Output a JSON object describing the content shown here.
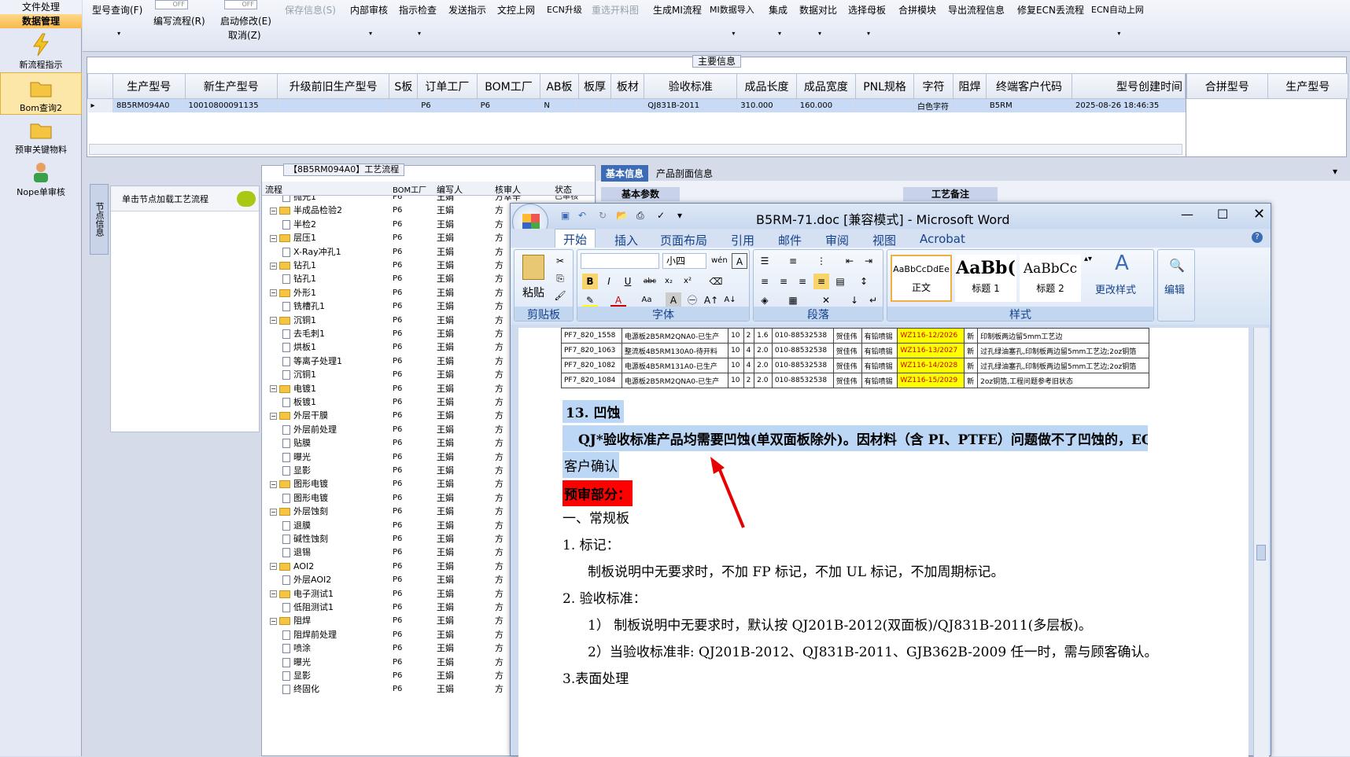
{
  "sidebar": {
    "top_label": "文件处理",
    "section_label": "数据管理",
    "items": [
      {
        "label": "新流程指示",
        "icon": "lightning-icon"
      },
      {
        "label": "Bom查询2",
        "icon": "folder-icon"
      },
      {
        "label": "预审关键物料",
        "icon": "folder-icon"
      },
      {
        "label": "Nope单审核",
        "icon": "user-icon"
      }
    ]
  },
  "toolbar": {
    "items": [
      {
        "label": "型号查询(F)",
        "dropdown": "▾"
      },
      {
        "label": "编写流程(R)"
      },
      {
        "label": "启动修改(E)",
        "sub": "取消(Z)"
      },
      {
        "label": "保存信息(S)"
      },
      {
        "label": "内部审核",
        "dropdown": "▾"
      },
      {
        "label": "指示检查",
        "dropdown": "▾"
      },
      {
        "label": "发送指示"
      },
      {
        "label": "文控上网"
      },
      {
        "label": "ECN升级"
      },
      {
        "label": "重选开料图"
      },
      {
        "label": "生成MI流程"
      },
      {
        "label": "MI数据导入",
        "dropdown": "▾"
      },
      {
        "label": "集成",
        "dropdown": "▾"
      },
      {
        "label": "数据对比",
        "dropdown": "▾"
      },
      {
        "label": "选择母板",
        "dropdown": "▾"
      },
      {
        "label": "合拼模块"
      },
      {
        "label": "导出流程信息"
      },
      {
        "label": "修复ECN丢流程"
      },
      {
        "label": "ECN自动上网",
        "dropdown": "▾"
      }
    ],
    "toggle_off": "OFF"
  },
  "main_info": {
    "legend": "主要信息",
    "columns": [
      "生产型号",
      "新生产型号",
      "升级前旧生产型号",
      "S板",
      "订单工厂",
      "BOM工厂",
      "AB板",
      "板厚",
      "板材",
      "验收标准",
      "成品长度",
      "成品宽度",
      "PNL规格",
      "字符",
      "阻焊",
      "终端客户代码",
      "型号创建时间"
    ],
    "row": [
      "8B5RM094A0",
      "10010800091135",
      "",
      "",
      "P6",
      "P6",
      "N",
      "",
      "",
      "QJ831B-2011",
      "310.000",
      "160.000",
      "",
      "白色字符",
      "",
      "B5RM",
      "2025-08-26 18:46:35"
    ],
    "side_columns": [
      "合拼型号",
      "生产型号"
    ]
  },
  "node_panel": {
    "vertical_tab": "节点信息",
    "header": "单击节点加载工艺流程"
  },
  "process": {
    "legend": "【8B5RM094A0】工艺流程",
    "columns": [
      "流程",
      "BOM工厂",
      "编写人",
      "核审人",
      "状态"
    ],
    "rows": [
      {
        "name": "抛光1",
        "level": 2,
        "type": "doc",
        "factory": "P6",
        "writer": "王娟",
        "reviewer": "方幸辛",
        "status": "已审核"
      },
      {
        "name": "半成品检验2",
        "level": 1,
        "type": "folder",
        "factory": "P6",
        "writer": "王娟",
        "reviewer": "方"
      },
      {
        "name": "半检2",
        "level": 2,
        "type": "doc",
        "factory": "P6",
        "writer": "王娟",
        "reviewer": "方"
      },
      {
        "name": "层压1",
        "level": 1,
        "type": "folder",
        "factory": "P6",
        "writer": "王娟",
        "reviewer": "方"
      },
      {
        "name": "X-Ray冲孔1",
        "level": 2,
        "type": "doc",
        "factory": "P6",
        "writer": "王娟",
        "reviewer": "方"
      },
      {
        "name": "钻孔1",
        "level": 1,
        "type": "folder",
        "factory": "P6",
        "writer": "王娟",
        "reviewer": "方"
      },
      {
        "name": "钻孔1",
        "level": 2,
        "type": "doc",
        "factory": "P6",
        "writer": "王娟",
        "reviewer": "方"
      },
      {
        "name": "外形1",
        "level": 1,
        "type": "folder",
        "factory": "P6",
        "writer": "王娟",
        "reviewer": "方"
      },
      {
        "name": "铣槽孔1",
        "level": 2,
        "type": "doc",
        "factory": "P6",
        "writer": "王娟",
        "reviewer": "方"
      },
      {
        "name": "沉铜1",
        "level": 1,
        "type": "folder",
        "factory": "P6",
        "writer": "王娟",
        "reviewer": "方"
      },
      {
        "name": "去毛刺1",
        "level": 2,
        "type": "doc",
        "factory": "P6",
        "writer": "王娟",
        "reviewer": "方"
      },
      {
        "name": "烘板1",
        "level": 2,
        "type": "doc",
        "factory": "P6",
        "writer": "王娟",
        "reviewer": "方"
      },
      {
        "name": "等离子处理1",
        "level": 2,
        "type": "doc",
        "factory": "P6",
        "writer": "王娟",
        "reviewer": "方"
      },
      {
        "name": "沉铜1",
        "level": 2,
        "type": "doc",
        "factory": "P6",
        "writer": "王娟",
        "reviewer": "方"
      },
      {
        "name": "电镀1",
        "level": 1,
        "type": "folder",
        "factory": "P6",
        "writer": "王娟",
        "reviewer": "方"
      },
      {
        "name": "板镀1",
        "level": 2,
        "type": "doc",
        "factory": "P6",
        "writer": "王娟",
        "reviewer": "方"
      },
      {
        "name": "外层干膜",
        "level": 1,
        "type": "folder",
        "factory": "P6",
        "writer": "王娟",
        "reviewer": "方"
      },
      {
        "name": "外层前处理",
        "level": 2,
        "type": "doc",
        "factory": "P6",
        "writer": "王娟",
        "reviewer": "方"
      },
      {
        "name": "贴膜",
        "level": 2,
        "type": "doc",
        "factory": "P6",
        "writer": "王娟",
        "reviewer": "方"
      },
      {
        "name": "曝光",
        "level": 2,
        "type": "doc",
        "factory": "P6",
        "writer": "王娟",
        "reviewer": "方"
      },
      {
        "name": "显影",
        "level": 2,
        "type": "doc",
        "factory": "P6",
        "writer": "王娟",
        "reviewer": "方"
      },
      {
        "name": "图形电镀",
        "level": 1,
        "type": "folder",
        "factory": "P6",
        "writer": "王娟",
        "reviewer": "方"
      },
      {
        "name": "图形电镀",
        "level": 2,
        "type": "doc",
        "factory": "P6",
        "writer": "王娟",
        "reviewer": "方"
      },
      {
        "name": "外层蚀刻",
        "level": 1,
        "type": "folder",
        "factory": "P6",
        "writer": "王娟",
        "reviewer": "方"
      },
      {
        "name": "退膜",
        "level": 2,
        "type": "doc",
        "factory": "P6",
        "writer": "王娟",
        "reviewer": "方"
      },
      {
        "name": "碱性蚀刻",
        "level": 2,
        "type": "doc",
        "factory": "P6",
        "writer": "王娟",
        "reviewer": "方"
      },
      {
        "name": "退锡",
        "level": 2,
        "type": "doc",
        "factory": "P6",
        "writer": "王娟",
        "reviewer": "方"
      },
      {
        "name": "AOI2",
        "level": 1,
        "type": "folder",
        "factory": "P6",
        "writer": "王娟",
        "reviewer": "方"
      },
      {
        "name": "外层AOI2",
        "level": 2,
        "type": "doc",
        "factory": "P6",
        "writer": "王娟",
        "reviewer": "方"
      },
      {
        "name": "电子测试1",
        "level": 1,
        "type": "folder",
        "factory": "P6",
        "writer": "王娟",
        "reviewer": "方"
      },
      {
        "name": "低阻测试1",
        "level": 2,
        "type": "doc",
        "factory": "P6",
        "writer": "王娟",
        "reviewer": "方"
      },
      {
        "name": "阻焊",
        "level": 1,
        "type": "folder",
        "factory": "P6",
        "writer": "王娟",
        "reviewer": "方"
      },
      {
        "name": "阻焊前处理",
        "level": 2,
        "type": "doc",
        "factory": "P6",
        "writer": "王娟",
        "reviewer": "方"
      },
      {
        "name": "喷涂",
        "level": 2,
        "type": "doc",
        "factory": "P6",
        "writer": "王娟",
        "reviewer": "方"
      },
      {
        "name": "曝光",
        "level": 2,
        "type": "doc",
        "factory": "P6",
        "writer": "王娟",
        "reviewer": "方"
      },
      {
        "name": "显影",
        "level": 2,
        "type": "doc",
        "factory": "P6",
        "writer": "王娟",
        "reviewer": "方"
      },
      {
        "name": "终固化",
        "level": 2,
        "type": "doc",
        "factory": "P6",
        "writer": "王娟",
        "reviewer": "方"
      }
    ]
  },
  "info_panel": {
    "tabs": [
      "基本信息",
      "产品剖面信息"
    ],
    "sub_tab1": "基本参数",
    "sub_tab2": "工艺备注"
  },
  "word": {
    "title": "B5RM-71.doc [兼容模式] - Microsoft Word",
    "ribbon_tabs": [
      "开始",
      "插入",
      "页面布局",
      "引用",
      "邮件",
      "审阅",
      "视图",
      "Acrobat"
    ],
    "groups": [
      "剪贴板",
      "字体",
      "段落",
      "样式"
    ],
    "paste_label": "粘贴",
    "font_size": "小四",
    "styles": [
      {
        "preview": "AaBbCcDdEe",
        "name": "正文"
      },
      {
        "preview": "AaBb(",
        "name": "标题 1"
      },
      {
        "preview": "AaBbCc",
        "name": "标题 2"
      }
    ],
    "change_styles": "更改样式",
    "edit": "编辑",
    "table_rows": [
      [
        "PF7_820_1558",
        "电源板2B5RM2QNA0-已生产",
        "10",
        "2",
        "1.6",
        "010-88532538",
        "贺佳伟",
        "有铅喷锡",
        "WZ116-12/2026",
        "新",
        "印制板两边留5mm工艺边"
      ],
      [
        "PF7_820_1063",
        "整流板4B5RM130A0-待开料",
        "10",
        "4",
        "2.0",
        "010-88532538",
        "贺佳伟",
        "有铅喷锡",
        "WZ116-13/2027",
        "新",
        "过孔绿油塞孔,印制板两边留5mm工艺边;2oz铜箔"
      ],
      [
        "PF7_820_1082",
        "电源板4B5RM131A0-已生产",
        "10",
        "4",
        "2.0",
        "010-88532538",
        "贺佳伟",
        "有铅喷锡",
        "WZ116-14/2028",
        "新",
        "过孔绿油塞孔,印制板两边留5mm工艺边;2oz铜箔"
      ],
      [
        "PF7_820_1084",
        "电源板2B5RM2QNA0-已生产",
        "10",
        "2",
        "2.0",
        "010-88532538",
        "贺佳伟",
        "有铅喷锡",
        "WZ116-15/2029",
        "新",
        "2oz铜箔,工程问题参考旧状态"
      ]
    ],
    "heading13": "13. 凹蚀",
    "qj_line1": "QJ*验收标准产品均需要凹蚀(单双面板除外)。因材料（含 PI、PTFE）问题做不了凹蚀的，EQ",
    "qj_line2": "客户确认",
    "pre_review": "预审部分：",
    "sec1": "一、常规板",
    "item1": "1.  标记：",
    "item1_text": "制板说明中无要求时，不加 FP 标记，不加 UL 标记，不加周期标记。",
    "item2": "2.  验收标准：",
    "item2_a": "1） 制板说明中无要求时，默认按 QJ201B-2012(双面板)/QJ831B-2011(多层板)。",
    "item2_b": "2）当验收标准非: QJ201B-2012、QJ831B-2011、GJB362B-2009 任一时，需与顾客确认。",
    "item3": "3.表面处理"
  },
  "colors": {
    "highlight": "#bcd6f5",
    "red": "#ff0000",
    "yellow": "#ffff00"
  }
}
